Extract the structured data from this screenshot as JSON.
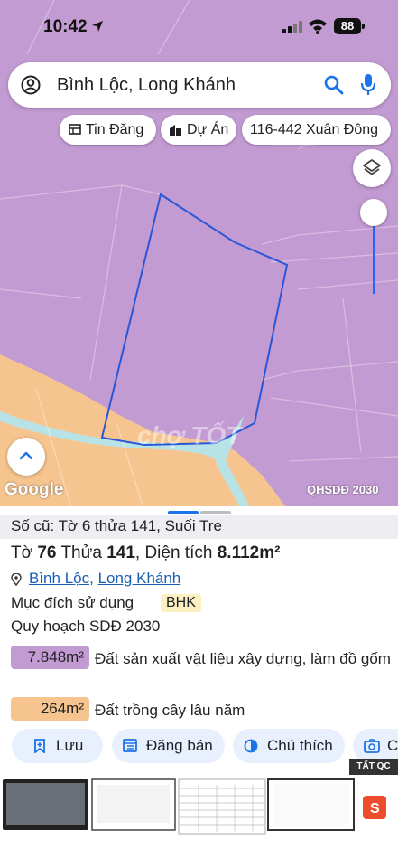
{
  "status_bar": {
    "time": "10:42",
    "battery": "88"
  },
  "search": {
    "query": "Bình Lộc, Long Khánh"
  },
  "chips": [
    {
      "label": "Tin Đăng"
    },
    {
      "label": "Dự Án"
    },
    {
      "label": "116-442 Xuân Đông"
    }
  ],
  "map": {
    "provider": "Google",
    "layer_label": "QHSDĐ 2030",
    "watermark": "chợ TỐT",
    "colors": {
      "mixed_use": "#c39bd3",
      "perennial": "#f6c58f",
      "river": "#b8e3e6",
      "boundary": "#2a56d6"
    }
  },
  "sheet": {
    "old_ref": "Số cũ: Tờ 6 thửa 141, Suối Tre",
    "parcel": {
      "sheet_label": "Tờ",
      "sheet_no": "76",
      "plot_label": "Thửa",
      "plot_no": "141",
      "area_label": ", Diện tích",
      "area_value": "8.112m²"
    },
    "address": {
      "commune": "Bình Lộc",
      "separator": ", ",
      "city": "Long Khánh"
    },
    "purpose": {
      "label": "Mục đích sử dụng",
      "code": "BHK"
    },
    "plan_label": "Quy hoạch SDĐ 2030",
    "zones": [
      {
        "area": "7.848m²",
        "desc": "Đất sản xuất vật liệu xây dựng, làm đồ gốm",
        "color": "#c39bd3"
      },
      {
        "area": "264m²",
        "desc": "Đất trồng cây lâu năm",
        "color": "#f6c58f"
      }
    ],
    "actions": [
      {
        "label": "Lưu"
      },
      {
        "label": "Đăng bán"
      },
      {
        "label": "Chú thích"
      },
      {
        "label": "C"
      }
    ]
  },
  "ads": {
    "badge": "TẤT QC"
  }
}
